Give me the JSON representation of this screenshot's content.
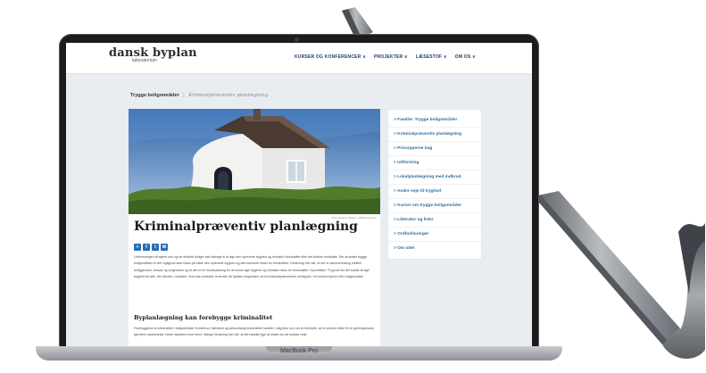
{
  "site": {
    "logo_title": "dansk byplan",
    "logo_subtitle": "laboratorium",
    "nav": [
      {
        "label": "KURSER OG KONFERENCER ∨"
      },
      {
        "label": "PROJEKTER ∨"
      },
      {
        "label": "LÆSESTOF ∨"
      },
      {
        "label": "OM OS ∨"
      }
    ]
  },
  "breadcrumb": {
    "parent": "Trygge boligområder",
    "separator": "|",
    "current": "Kriminalpræventiv planlægning"
  },
  "article": {
    "photo_caption": "Foto: Kasper Nielsen / Mikkel Hastrup",
    "title": "Kriminalpræventiv planlægning",
    "share_icons": [
      "+",
      "f",
      "t",
      "✉"
    ],
    "intro": "Udformningen af byens rum og de enkelte boliger kan bidrage til at øge den oplevede tryghed og mindske kriminalitet eller det direkte modsatte. Der at skabe trygge boligområder er det vigtigt at have fokus på både den oplevede tryghed og den konkrete risiko for kriminalitet. Forskning har vist, at der er sammenhæng mellem beliggenhed, forsvar og omgivelser og at det er en forudsaetning for at kunne øge tryghed og mindske risiko for kriminalitet i byområder. Til grund for det stadie at øge tryghed for alle, der færdes i området, hvis man arbejder at ændre de fysiske omgivelser ud fra kriminalpræventive principper i et konkret byrum eller boligområde.",
    "section_heading": "Byplanlægning kan forebygge kriminalitet",
    "section_text": "Forebyggelse af kriminalitet i boligområder fx indbrud, hærværk og personfarlig kriminalitet handler i dag ikke kun om at forhindre, at en person bliver til en gerningsmand igennem uddannelse, bedre akademi med mere. Mange forskning har vist, at det handler tjge at møde om de fysiske rette"
  },
  "sidebar": {
    "items": [
      {
        "label": "> Famílie: Trygge boligområder"
      },
      {
        "label": "> Kriminalpræventiv planlægning"
      },
      {
        "label": "> Principperne bag"
      },
      {
        "label": "> Udforming"
      },
      {
        "label": "> Lokalplanlægning med indbrud"
      },
      {
        "label": "> Andre veje til tryghed"
      },
      {
        "label": "> Kurser om trygge boligområder"
      },
      {
        "label": "> Litteratur og links"
      },
      {
        "label": "> Ordforklaringer"
      },
      {
        "label": "> Om sitet"
      }
    ]
  },
  "laptop": {
    "model_label": "MacBook Pro"
  },
  "colors": {
    "accent": "#2c6f9e",
    "nav_text": "#1f3a5a",
    "screen_bg": "#e9edf1",
    "crowbar": "#7e8287"
  }
}
